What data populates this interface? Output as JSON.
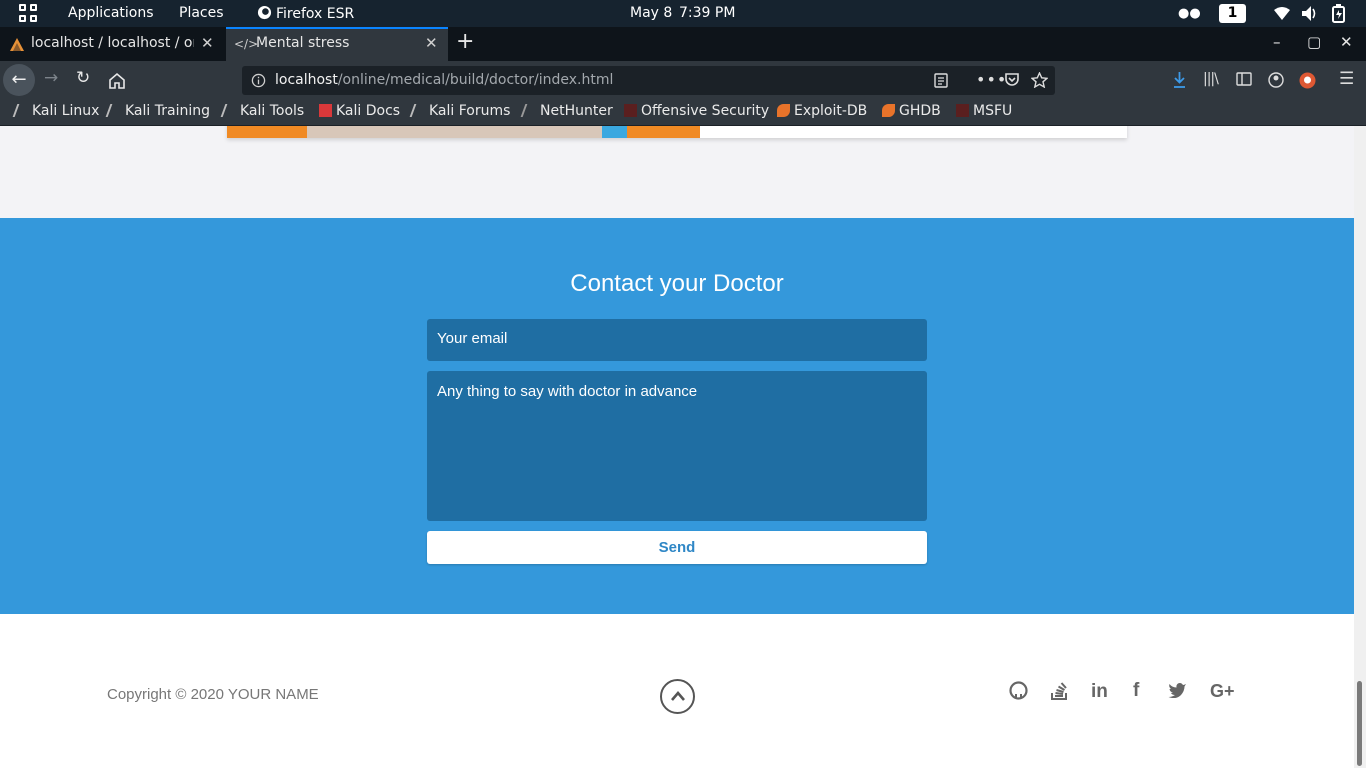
{
  "system_bar": {
    "applications": "Applications",
    "places": "Places",
    "browser": "Firefox ESR",
    "date": "May 8",
    "time": "7:39 PM",
    "workspace": "1"
  },
  "tabs": [
    {
      "label": "localhost / localhost / onli",
      "active": false
    },
    {
      "label": "Mental stress",
      "active": true
    }
  ],
  "new_tab_symbol": "+",
  "window_controls": {
    "minimize": "–",
    "maximize": "▢",
    "close": "✕"
  },
  "address": {
    "host": "localhost",
    "path": "/online/medical/build/doctor/index.html"
  },
  "bookmarks": [
    "Kali Linux",
    "Kali Training",
    "Kali Tools",
    "Kali Docs",
    "Kali Forums",
    "NetHunter",
    "Offensive Security",
    "Exploit-DB",
    "GHDB",
    "MSFU"
  ],
  "contact": {
    "title": "Contact your Doctor",
    "email_placeholder": "Your email",
    "message_placeholder": "Any thing to say with doctor in advance",
    "send_label": "Send"
  },
  "footer": {
    "copyright": "Copyright © 2020 YOUR NAME",
    "social": [
      "github-icon",
      "stack-overflow-icon",
      "linkedin-icon",
      "facebook-icon",
      "twitter-icon",
      "google-plus-icon"
    ]
  },
  "colors": {
    "contact_bg": "#3498db",
    "field_bg": "#1f6ea3",
    "send_text": "#2f87c6",
    "tab_accent": "#0a84ff"
  }
}
